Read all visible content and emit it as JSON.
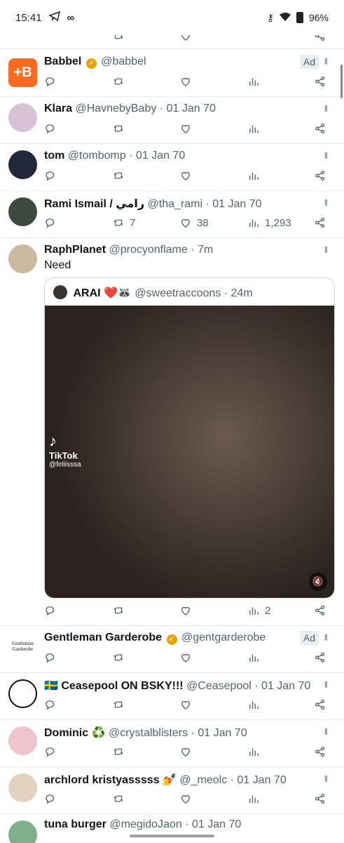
{
  "status": {
    "time": "15:41",
    "battery": "96%"
  },
  "tweets": [
    {
      "id": "babbel",
      "name": "Babbel",
      "verified": true,
      "handle": "@babbel",
      "ad": "Ad",
      "avatar_color": "#ff6a1f",
      "avatar_text": "+B",
      "stats": {
        "replies": "",
        "retweets": "",
        "likes": "",
        "views": ""
      }
    },
    {
      "id": "klara",
      "name": "Klara",
      "handle": "@HavnebyBaby",
      "time": "· 01 Jan 70",
      "avatar_color": "#d8c3d6",
      "stats": {
        "replies": "",
        "retweets": "",
        "likes": "",
        "views": ""
      }
    },
    {
      "id": "tom",
      "name": "tom",
      "handle": "@tombomp",
      "time": "· 01 Jan 70",
      "avatar_color": "#20283a",
      "stats": {
        "replies": "",
        "retweets": "",
        "likes": "",
        "views": ""
      }
    },
    {
      "id": "rami",
      "name": "Rami Ismail / رامي",
      "handle": "@tha_rami",
      "time": "· 01 Jan 70",
      "avatar_color": "#3c4a40",
      "stats": {
        "replies": "",
        "retweets": "7",
        "likes": "38",
        "views": "1,293"
      }
    },
    {
      "id": "raph",
      "name": "RaphPlanet",
      "handle": "@procyonflame",
      "time": "· 7m",
      "text": "Need",
      "avatar_color": "#cbb9a0",
      "quote": {
        "name": "ARAI ❤️🦝",
        "handle": "@sweetraccoons",
        "time": "· 24m",
        "media_label": "TikTok",
        "media_user": "@feliisssa"
      },
      "stats": {
        "replies": "",
        "retweets": "",
        "likes": "",
        "views": "2"
      }
    },
    {
      "id": "gentleman",
      "name": "Gentleman Garderobe",
      "verified": true,
      "handle": "@gentgarderobe",
      "ad": "Ad",
      "avatar_color": "#ffffff",
      "avatar_text": "Gentleman Garderobe",
      "stats": {
        "replies": "",
        "retweets": "",
        "likes": "",
        "views": ""
      }
    },
    {
      "id": "ceasepool",
      "name": "🇸🇪 Ceasepool ON BSKY!!!",
      "handle": "@Ceasepool",
      "time": "· 01 Jan 70",
      "avatar_color": "#111111",
      "stats": {
        "replies": "",
        "retweets": "",
        "likes": "",
        "views": ""
      }
    },
    {
      "id": "dominic",
      "name": "Dominic ♻️",
      "handle": "@crystalblisters",
      "time": "· 01 Jan 70",
      "avatar_color": "#f0c4cc",
      "stats": {
        "replies": "",
        "retweets": "",
        "likes": "",
        "views": ""
      }
    },
    {
      "id": "archlord",
      "name": "archlord kristyasssss 💅",
      "handle": "@_meolc",
      "time": "· 01 Jan 70",
      "avatar_color": "#e2d2c0",
      "stats": {
        "replies": "",
        "retweets": "",
        "likes": "",
        "views": ""
      }
    },
    {
      "id": "tuna",
      "name": "tuna burger",
      "handle": "@megidoJaon",
      "time": "· 01 Jan 70",
      "avatar_color": "#7fb08a"
    }
  ]
}
